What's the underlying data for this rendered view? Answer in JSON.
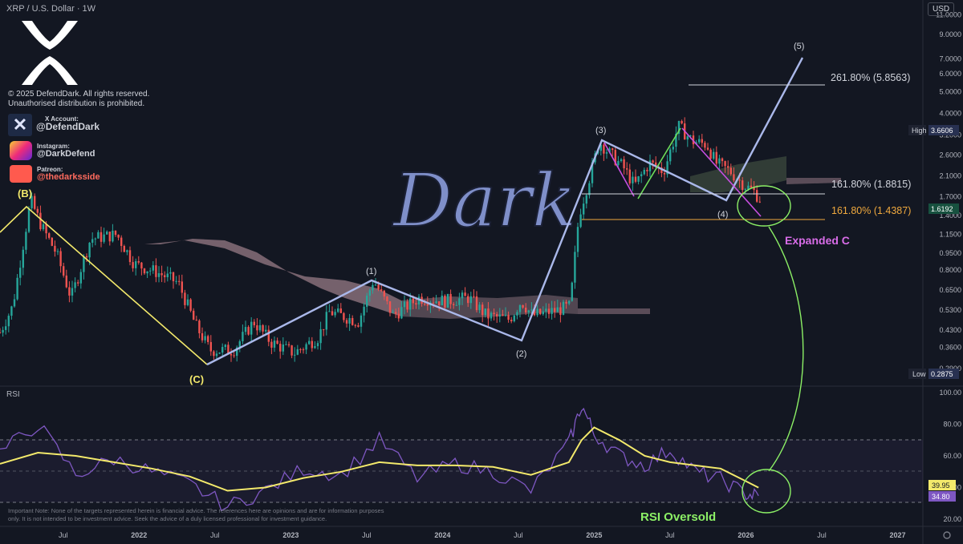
{
  "header": {
    "title": "XRP / U.S. Dollar · 1W",
    "currency": "USD"
  },
  "branding": {
    "copyright": "© 2025 DefendDark. All rights reserved.",
    "notice": "Unauthorised distribution is prohibited.",
    "x_label": "X Account:",
    "x_handle": "@DefendDark",
    "instagram_label": "Instagram:",
    "instagram_handle": "@DarkDefend",
    "patreon_label": "Patreon:",
    "patreon_handle": "@thedarksside",
    "watermark": "Dark"
  },
  "disclaimer": "Important Note: None of the targets represented herein is financial advice. The references here are opinions and are for information purposes only. It is not intended to be investment advice. Seek the advice of a duly licensed professional for investment guidance.",
  "rsi_label": "RSI",
  "chart_data": [
    {
      "type": "line",
      "scale": "log",
      "ylim": [
        0.25,
        12.0
      ],
      "ytick_labels": [
        "11.0000",
        "9.0000",
        "7.0000",
        "6.0000",
        "5.0000",
        "4.0000",
        "3.2000",
        "2.6000",
        "2.1000",
        "1.7000",
        "1.4000",
        "1.1500",
        "0.9500",
        "0.8000",
        "0.6500",
        "0.5300",
        "0.4300",
        "0.3600",
        "0.2900"
      ],
      "ytick_values": [
        11.0,
        9.0,
        7.0,
        6.0,
        5.0,
        4.0,
        3.2,
        2.6,
        2.1,
        1.7,
        1.4,
        1.15,
        0.95,
        0.8,
        0.65,
        0.53,
        0.43,
        0.36,
        0.29
      ],
      "xtick_labels": [
        "Jul",
        "2022",
        "Jul",
        "2023",
        "Jul",
        "2024",
        "Jul",
        "2025",
        "Jul",
        "2026",
        "Jul",
        "2027"
      ],
      "xtick_values": [
        "2021-07",
        "2022-01",
        "2022-07",
        "2023-01",
        "2023-07",
        "2024-01",
        "2024-07",
        "2025-01",
        "2025-07",
        "2026-01",
        "2026-07",
        "2027-01"
      ],
      "xlim": [
        "2021-02",
        "2027-03"
      ],
      "series": [
        {
          "x": [
            "2021-02-01",
            "2021-03-01",
            "2021-04-14",
            "2021-05-10",
            "2021-06-15",
            "2021-07-20",
            "2021-09-06",
            "2021-11-08",
            "2021-12-20",
            "2022-02-14",
            "2022-04-04",
            "2022-05-16",
            "2022-06-20",
            "2022-08-15",
            "2022-10-03",
            "2022-11-14",
            "2023-01-09",
            "2023-03-06",
            "2023-04-03",
            "2023-06-12",
            "2023-07-17",
            "2023-09-04",
            "2023-11-06",
            "2024-01-08",
            "2024-03-04",
            "2024-04-15",
            "2024-06-10",
            "2024-07-08",
            "2024-08-05",
            "2024-10-07",
            "2024-11-04",
            "2024-11-25",
            "2024-12-30",
            "2025-01-13",
            "2025-02-03",
            "2025-03-10",
            "2025-04-07",
            "2025-05-12",
            "2025-06-16",
            "2025-07-21",
            "2025-08-25",
            "2025-09-29",
            "2025-10-20",
            "2025-11-24",
            "2025-12-29",
            "2026-01-19",
            "2026-02-09"
          ],
          "values": [
            0.42,
            0.55,
            1.64,
            1.25,
            0.95,
            0.6,
            1.1,
            1.15,
            0.85,
            0.78,
            0.7,
            0.45,
            0.35,
            0.35,
            0.47,
            0.38,
            0.34,
            0.4,
            0.52,
            0.47,
            0.72,
            0.5,
            0.6,
            0.58,
            0.6,
            0.5,
            0.48,
            0.58,
            0.5,
            0.53,
            0.55,
            1.4,
            2.4,
            3.0,
            2.7,
            2.3,
            1.9,
            2.4,
            2.2,
            3.5,
            3.0,
            2.9,
            2.4,
            2.2,
            1.9,
            1.8,
            1.62
          ]
        }
      ],
      "wave_labels": [
        "(B)",
        "(C)",
        "(1)",
        "(2)",
        "(3)",
        "(4)",
        "(5)"
      ],
      "fib_levels": [
        {
          "label": "261.80% (5.8563)",
          "value": 5.8563,
          "color": "#d1d4dc"
        },
        {
          "label": "161.80% (1.8815)",
          "value": 1.8815,
          "color": "#d1d4dc"
        },
        {
          "label": "161.80% (1.4387)",
          "value": 1.4387,
          "color": "#f0a93e"
        }
      ],
      "badges": {
        "high_label": "High",
        "high_value": "3.6606",
        "low_label": "Low",
        "low_value": "0.2875",
        "last_value": "1.6192"
      },
      "annotations": [
        "Expanded C",
        "RSI Oversold"
      ]
    },
    {
      "type": "line",
      "title": "RSI",
      "ylim": [
        20,
        100
      ],
      "ytick_labels": [
        "100.00",
        "80.00",
        "60.00",
        "40.00",
        "20.00"
      ],
      "ytick_values": [
        100,
        80,
        60,
        40,
        20
      ],
      "band": [
        30,
        70
      ],
      "series": [
        {
          "x": [
            "2021-02",
            "2021-05",
            "2021-08",
            "2021-11",
            "2022-02",
            "2022-05",
            "2022-08",
            "2022-11",
            "2023-02",
            "2023-05",
            "2023-08",
            "2023-11",
            "2024-02",
            "2024-05",
            "2024-08",
            "2024-11",
            "2024-12",
            "2025-01",
            "2025-03",
            "2025-05",
            "2025-07",
            "2025-09",
            "2025-11",
            "2026-01",
            "2026-02"
          ],
          "values": [
            62,
            80,
            48,
            58,
            50,
            42,
            28,
            38,
            52,
            48,
            70,
            46,
            55,
            50,
            38,
            68,
            92,
            74,
            60,
            54,
            64,
            50,
            45,
            36,
            34.8
          ]
        },
        {
          "x": [
            "2021-02",
            "2021-05",
            "2021-08",
            "2021-11",
            "2022-02",
            "2022-05",
            "2022-08",
            "2022-11",
            "2023-02",
            "2023-05",
            "2023-08",
            "2023-11",
            "2024-02",
            "2024-05",
            "2024-08",
            "2024-11",
            "2024-12",
            "2025-01",
            "2025-03",
            "2025-05",
            "2025-07",
            "2025-09",
            "2025-11",
            "2026-01",
            "2026-02"
          ],
          "values": [
            55,
            62,
            60,
            56,
            52,
            47,
            38,
            40,
            46,
            50,
            56,
            54,
            54,
            53,
            48,
            56,
            70,
            78,
            70,
            60,
            56,
            54,
            52,
            44,
            39.95
          ]
        }
      ],
      "badges": {
        "ma_value": "39.95",
        "rsi_value": "34.80"
      }
    }
  ],
  "colors": {
    "background": "#131722",
    "bull": "#26a69a",
    "bear": "#ef5350",
    "wave_main": "#aab8ea",
    "abc": "#f3e96b",
    "subwave": "#c74ee0",
    "subwave_up": "#6fe05a",
    "rsi_line": "#7e57c2",
    "rsi_ma": "#f3e96b",
    "annot_green": "#8cf066",
    "annot_pink": "#d86ce8",
    "fib_orange": "#f0a93e"
  }
}
